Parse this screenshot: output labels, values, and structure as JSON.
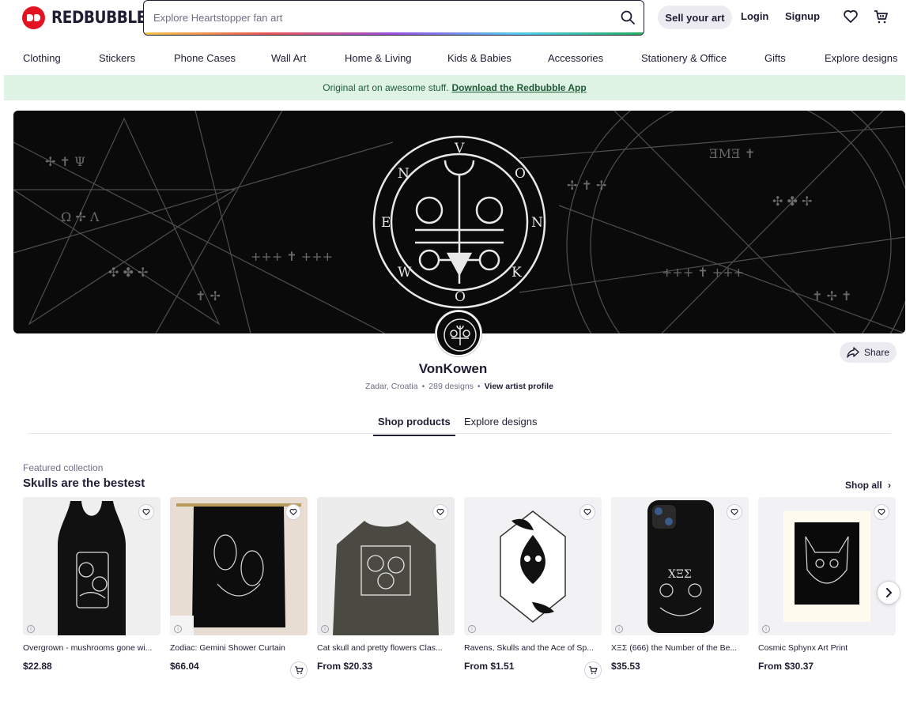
{
  "header": {
    "logo_text": "REDBUBBLE",
    "search_placeholder": "Explore Heartstopper fan art",
    "sell_label": "Sell your art",
    "login_label": "Login",
    "signup_label": "Signup"
  },
  "nav": {
    "items": [
      {
        "label": "Clothing"
      },
      {
        "label": "Stickers"
      },
      {
        "label": "Phone Cases"
      },
      {
        "label": "Wall Art"
      },
      {
        "label": "Home & Living"
      },
      {
        "label": "Kids & Babies"
      },
      {
        "label": "Accessories"
      },
      {
        "label": "Stationery & Office"
      },
      {
        "label": "Gifts"
      },
      {
        "label": "Explore designs"
      }
    ]
  },
  "promo": {
    "text": "Original art on awesome stuff.",
    "link": "Download the Redbubble App"
  },
  "artist": {
    "name": "VonKowen",
    "location": "Zadar, Croatia",
    "designs": "289 designs",
    "profile_link": "View artist profile",
    "share_label": "Share"
  },
  "tabs": {
    "shop": "Shop products",
    "explore": "Explore designs"
  },
  "collection": {
    "label": "Featured collection",
    "title": "Skulls are the bestest",
    "shop_all": "Shop all"
  },
  "products": [
    {
      "title": "Overgrown - mushrooms gone wi...",
      "price": "$22.88",
      "cart": false
    },
    {
      "title": "Zodiac: Gemini Shower Curtain",
      "price": "$66.04",
      "cart": true
    },
    {
      "title": "Cat skull and pretty flowers Clas...",
      "price": "From $20.33",
      "cart": false
    },
    {
      "title": "Ravens, Skulls and the Ace of Sp...",
      "price": "From $1.51",
      "cart": true
    },
    {
      "title": "ΧΞΣ (666) the Number of the Be...",
      "price": "$35.53",
      "cart": false
    },
    {
      "title": "Cosmic Sphynx Art Print",
      "price": "From $30.37",
      "cart": false
    }
  ],
  "colors": {
    "brand_red": "#e41321",
    "text_dark": "#1e1d33",
    "promo_bg": "#dff3e5"
  }
}
